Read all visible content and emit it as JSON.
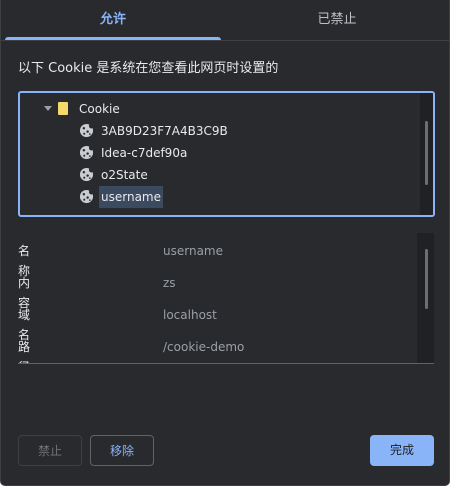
{
  "tabs": [
    {
      "label": "允许",
      "active": true
    },
    {
      "label": "已禁止",
      "active": false
    }
  ],
  "description": "以下 Cookie 是系统在您查看此网页时设置的",
  "tree": {
    "folder": {
      "label": "Cookie",
      "icon": "folder-icon"
    },
    "cookies": [
      {
        "label": "3AB9D23F7A4B3C9B",
        "icon": "cookie-icon"
      },
      {
        "label": "Idea-c7def90a",
        "icon": "cookie-icon"
      },
      {
        "label": "o2State",
        "icon": "cookie-icon"
      },
      {
        "label": "username",
        "icon": "cookie-icon",
        "selected": true
      }
    ]
  },
  "details": [
    {
      "key": "名称",
      "value": "username"
    },
    {
      "key": "内容",
      "value": "zs"
    },
    {
      "key": "域名",
      "value": "localhost"
    },
    {
      "key": "路径",
      "value": "/cookie-demo"
    }
  ],
  "buttons": {
    "block": "禁止",
    "remove": "移除",
    "done": "完成"
  },
  "colors": {
    "background": "#292a2d",
    "accent": "#8ab4f8",
    "text": "#e8eaed",
    "muted_text": "#9aa0a6",
    "selection": "#3c4a60",
    "folder": "#f5d96a"
  }
}
